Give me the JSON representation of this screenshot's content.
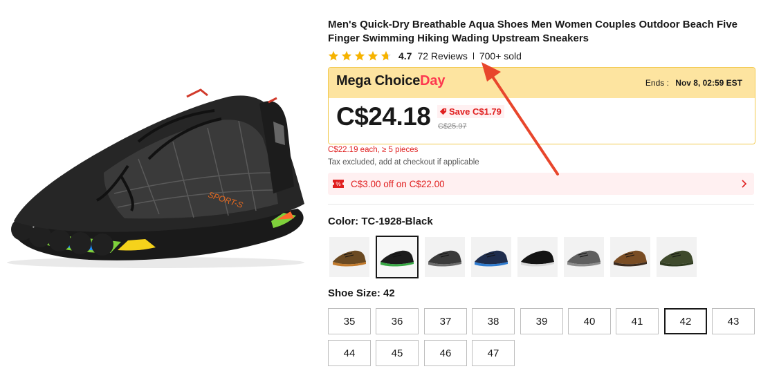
{
  "product": {
    "title": "Men's Quick-Dry Breathable Aqua Shoes Men Women Couples Outdoor Beach Five Finger Swimming Hiking Wading Upstream Sneakers",
    "rating": "4.7",
    "reviews": "72 Reviews",
    "sold": "700+ sold",
    "stars": 4.7,
    "star_color": "#f6b300",
    "image_icon": "shoe-image"
  },
  "deal": {
    "name_part1": "Mega Choice",
    "name_part2": "Day",
    "ends_label": "Ends :",
    "ends_time": "Nov 8, 02:59 EST",
    "price": "C$24.18",
    "save": "Save C$1.79",
    "original_price": "C$25.97",
    "bulk_price": "C$22.19 each, ≥ 5 pieces",
    "tax_note": "Tax excluded, add at checkout if applicable",
    "header_color": "#fde4a0",
    "accent_color": "#fd384f"
  },
  "coupon": {
    "text": "C$3.00 off on C$22.00",
    "icon": "coupon-icon"
  },
  "color_section": {
    "label": "Color: TC-1928-Black",
    "options": [
      {
        "name": "brown-orange",
        "upper": "#6b4a22",
        "sole": "#c27a2c",
        "selected": false
      },
      {
        "name": "black",
        "upper": "#1c1c1c",
        "sole": "#38a845",
        "selected": true
      },
      {
        "name": "grey-black",
        "upper": "#3a3a3a",
        "sole": "#6c6c6c",
        "selected": false
      },
      {
        "name": "navy",
        "upper": "#1f2d4d",
        "sole": "#2d7bd0",
        "selected": false
      },
      {
        "name": "black-white",
        "upper": "#141414",
        "sole": "#d9d9d9",
        "selected": false
      },
      {
        "name": "grey",
        "upper": "#5f5f5f",
        "sole": "#8d8d8d",
        "selected": false
      },
      {
        "name": "brown",
        "upper": "#7a4d24",
        "sole": "#3a2a1e",
        "selected": false
      },
      {
        "name": "olive",
        "upper": "#3f4a2c",
        "sole": "#2e3a1f",
        "selected": false
      }
    ]
  },
  "size_section": {
    "label": "Shoe Size: 42",
    "sizes": [
      "35",
      "36",
      "37",
      "38",
      "39",
      "40",
      "41",
      "42",
      "43",
      "44",
      "45",
      "46",
      "47"
    ],
    "selected": "42"
  }
}
